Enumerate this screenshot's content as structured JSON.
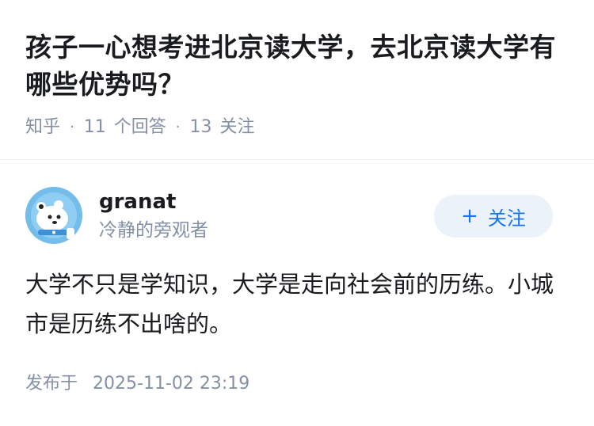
{
  "question": {
    "title": "孩子一心想考进北京读大学，去北京读大学有哪些优势吗？",
    "source": "知乎",
    "separator": "·",
    "answers_count": "11",
    "answers_label": "个回答",
    "followers_count": "13",
    "followers_label": "关注"
  },
  "author": {
    "name": "granat",
    "bio": "冷静的旁观者",
    "avatar_icon": "polar-bear-avatar-icon",
    "follow_button": {
      "icon": "plus-icon",
      "symbol": "+",
      "label": "关注"
    }
  },
  "answer": {
    "text": "大学不只是学知识，大学是走向社会前的历练。小城市是历练不出啥的。",
    "published_label": "发布于",
    "published_time": "2025-11-02 23:19"
  },
  "colors": {
    "title": "#191b1f",
    "meta": "#8590a6",
    "follow_bg": "#ebf2fa",
    "follow_text": "#1772f6",
    "divider": "#f0f0f2"
  }
}
